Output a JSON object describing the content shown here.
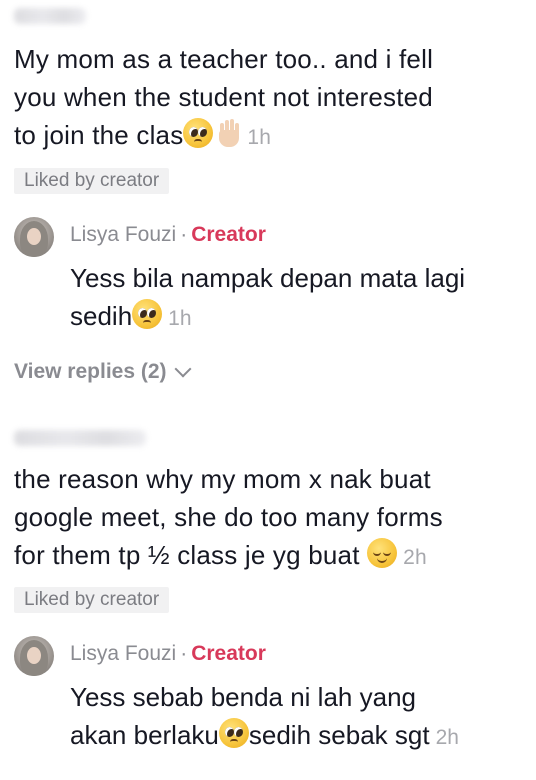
{
  "comments": [
    {
      "text_lines": [
        "My mom as a teacher too.. and i fell",
        "you when the student not interested",
        "to join the clas"
      ],
      "emojis": [
        "pleading-face",
        "raised-hand"
      ],
      "time": "1h",
      "liked_badge": "Liked by creator",
      "reply": {
        "author": "Lisya Fouzi",
        "separator": "·",
        "tag": "Creator",
        "text_lines": [
          "Yess bila nampak depan mata lagi",
          "sedih"
        ],
        "emojis": [
          "pleading-face"
        ],
        "time": "1h"
      },
      "view_replies": "View replies (2)"
    },
    {
      "text_lines": [
        "the reason why my mom x nak buat",
        "google meet, she do too many forms",
        "for them tp ½ class je yg buat"
      ],
      "emojis": [
        "relieved-face"
      ],
      "time": "2h",
      "liked_badge": "Liked by creator",
      "reply": {
        "author": "Lisya Fouzi",
        "separator": "·",
        "tag": "Creator",
        "text_lines": [
          "Yess sebab benda ni lah yang",
          "akan berlaku",
          "sedih sebak sgt"
        ],
        "emojis": [
          "pleading-face"
        ],
        "time": "2h"
      }
    }
  ],
  "colors": {
    "text": "#161823",
    "secondary": "#8a8b91",
    "timestamp": "#a7a8ad",
    "creator_tag": "#d8395a",
    "badge_bg": "#f1f1f2"
  }
}
